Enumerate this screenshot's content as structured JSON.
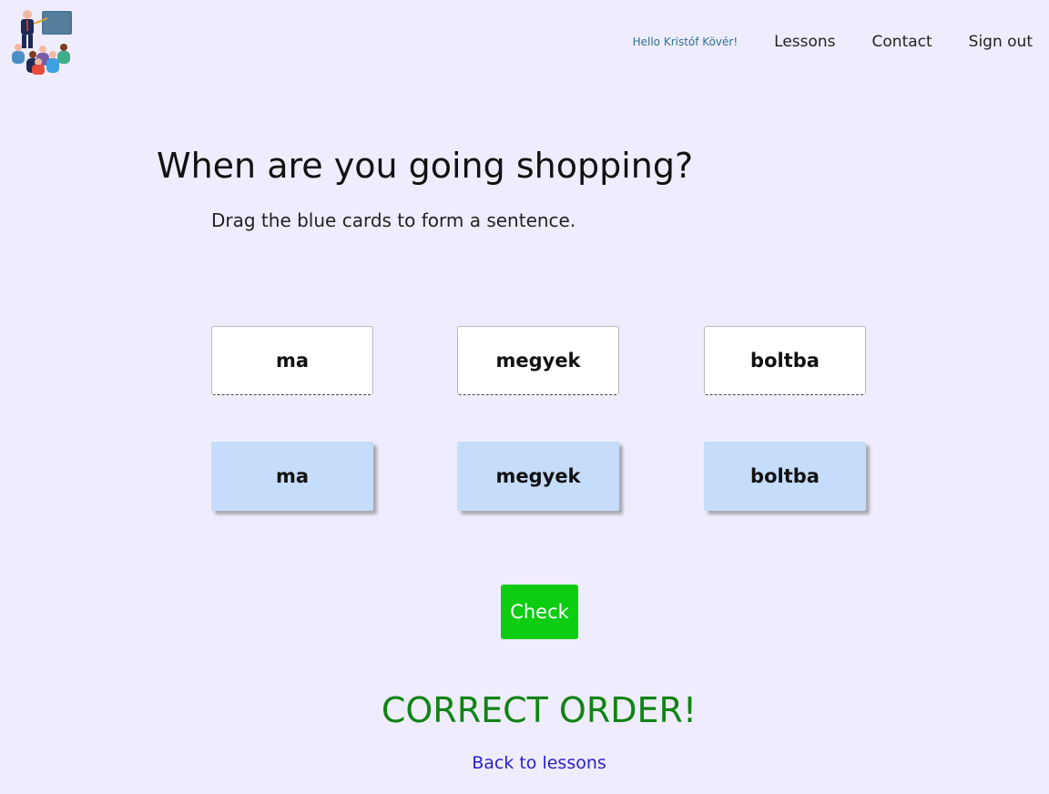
{
  "header": {
    "greeting": "Hello Kristóf Kövér!",
    "nav": {
      "lessons": "Lessons",
      "contact": "Contact",
      "sign_out": "Sign out"
    }
  },
  "exercise": {
    "title": "When are you going shopping?",
    "instructions": "Drag the blue cards to form a sentence.",
    "slots": [
      "ma",
      "megyek",
      "boltba"
    ],
    "cards": [
      "ma",
      "megyek",
      "boltba"
    ],
    "check_label": "Check",
    "result": "CORRECT ORDER!",
    "back_link": "Back to lessons"
  },
  "colors": {
    "background": "#efedfd",
    "card_blue": "#c5dcfb",
    "check_green": "#0ccd12",
    "result_green": "#108314",
    "link_blue": "#2a20c8"
  },
  "icons": {
    "logo": "teacher-classroom-icon"
  }
}
